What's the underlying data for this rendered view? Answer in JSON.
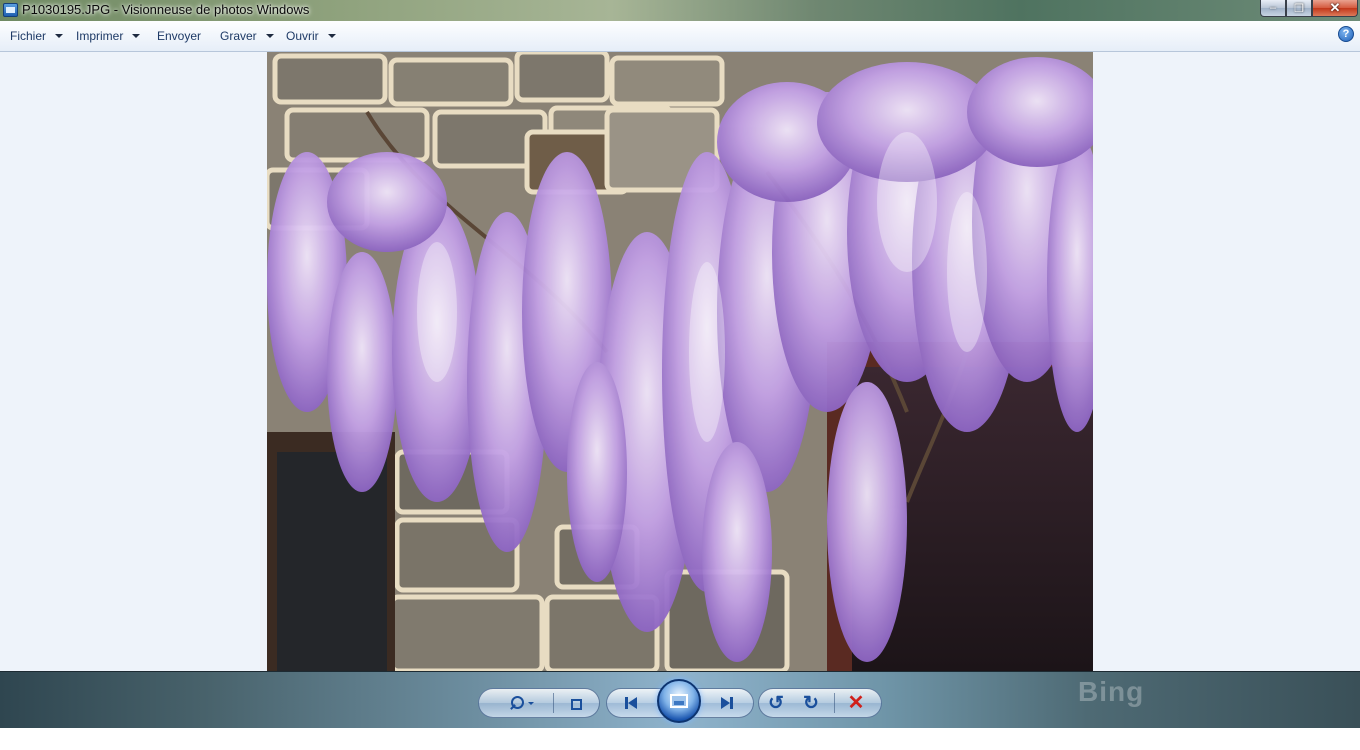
{
  "window": {
    "title": "P1030195.JPG - Visionneuse de photos Windows",
    "controls": {
      "minimize": "‒",
      "maximize": "❐",
      "close": "✕"
    }
  },
  "menu": {
    "items": [
      {
        "label": "Fichier",
        "has_dropdown": true
      },
      {
        "label": "Imprimer",
        "has_dropdown": true
      },
      {
        "label": "Envoyer",
        "has_dropdown": false
      },
      {
        "label": "Graver",
        "has_dropdown": true
      },
      {
        "label": "Ouvrir",
        "has_dropdown": true
      }
    ],
    "help_label": "?"
  },
  "photo": {
    "description_icon": "photo-of-wisteria-over-stone-wall"
  },
  "toolbar": {
    "background_brand": "Bing",
    "icons": [
      "zoom-icon",
      "fit-to-window-icon",
      "previous-icon",
      "slideshow-icon",
      "next-icon",
      "rotate-left-icon",
      "rotate-right-icon",
      "delete-icon"
    ],
    "rotate_left_glyph": "↺",
    "rotate_right_glyph": "↻",
    "delete_glyph": "✕"
  },
  "colors": {
    "accent": "#1a4f9c",
    "delete": "#d0201a",
    "menu_text": "#1e3a66"
  }
}
